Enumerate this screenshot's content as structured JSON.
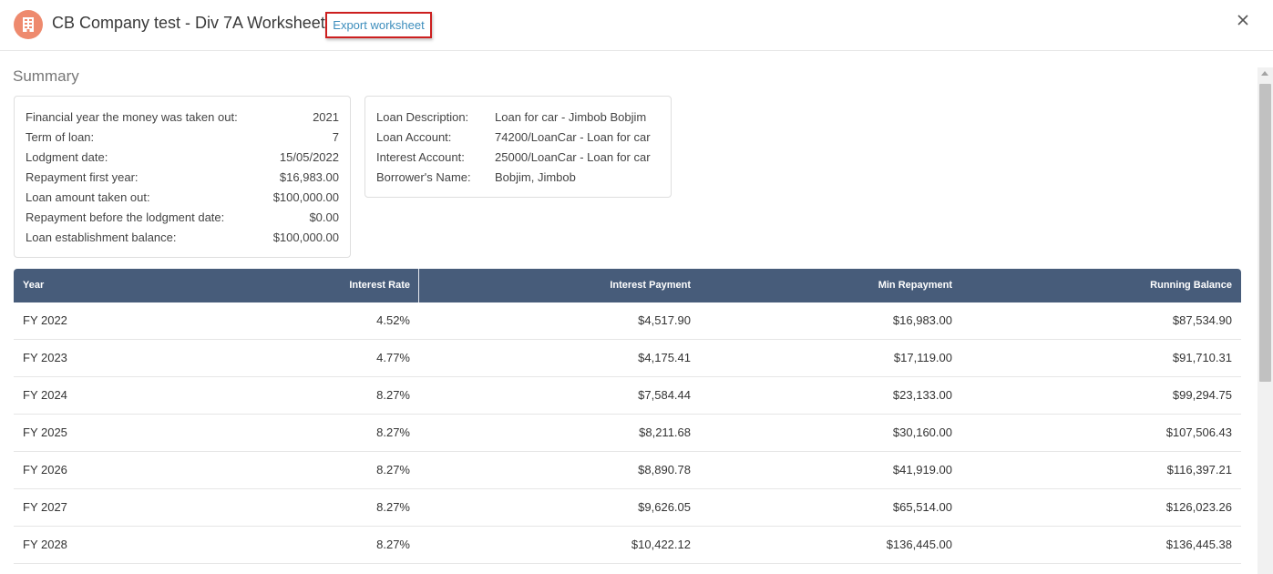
{
  "header": {
    "icon": "building-icon",
    "title": "CB Company test - Div 7A Worksheet",
    "export_label": "Export worksheet",
    "close_icon": "close-icon"
  },
  "summary": {
    "title": "Summary",
    "details": [
      {
        "label": "Financial year the money was taken out:",
        "value": "2021"
      },
      {
        "label": "Term of loan:",
        "value": "7"
      },
      {
        "label": "Lodgment date:",
        "value": "15/05/2022"
      },
      {
        "label": "Repayment first year:",
        "value": "$16,983.00"
      },
      {
        "label": "Loan amount taken out:",
        "value": "$100,000.00"
      },
      {
        "label": "Repayment before the lodgment date:",
        "value": "$0.00"
      },
      {
        "label": "Loan establishment balance:",
        "value": "$100,000.00"
      }
    ],
    "loan_info": [
      {
        "label": "Loan Description:",
        "value": "Loan for car - Jimbob Bobjim"
      },
      {
        "label": "Loan Account:",
        "value": "74200/LoanCar - Loan for car"
      },
      {
        "label": "Interest Account:",
        "value": "25000/LoanCar - Loan for car"
      },
      {
        "label": "Borrower's Name:",
        "value": "Bobjim, Jimbob"
      }
    ]
  },
  "table": {
    "columns": [
      "Year",
      "Interest Rate",
      "Interest Payment",
      "Min Repayment",
      "Running Balance"
    ],
    "rows": [
      {
        "year": "FY 2022",
        "rate": "4.52%",
        "interest": "$4,517.90",
        "min": "$16,983.00",
        "balance": "$87,534.90"
      },
      {
        "year": "FY 2023",
        "rate": "4.77%",
        "interest": "$4,175.41",
        "min": "$17,119.00",
        "balance": "$91,710.31"
      },
      {
        "year": "FY 2024",
        "rate": "8.27%",
        "interest": "$7,584.44",
        "min": "$23,133.00",
        "balance": "$99,294.75"
      },
      {
        "year": "FY 2025",
        "rate": "8.27%",
        "interest": "$8,211.68",
        "min": "$30,160.00",
        "balance": "$107,506.43"
      },
      {
        "year": "FY 2026",
        "rate": "8.27%",
        "interest": "$8,890.78",
        "min": "$41,919.00",
        "balance": "$116,397.21"
      },
      {
        "year": "FY 2027",
        "rate": "8.27%",
        "interest": "$9,626.05",
        "min": "$65,514.00",
        "balance": "$126,023.26"
      },
      {
        "year": "FY 2028",
        "rate": "8.27%",
        "interest": "$10,422.12",
        "min": "$136,445.00",
        "balance": "$136,445.38"
      }
    ]
  },
  "colors": {
    "table_header_bg": "#475c7a",
    "icon_bg": "#ee8a6e",
    "link": "#3c8dbc",
    "highlight_border": "#cc1f1f"
  }
}
